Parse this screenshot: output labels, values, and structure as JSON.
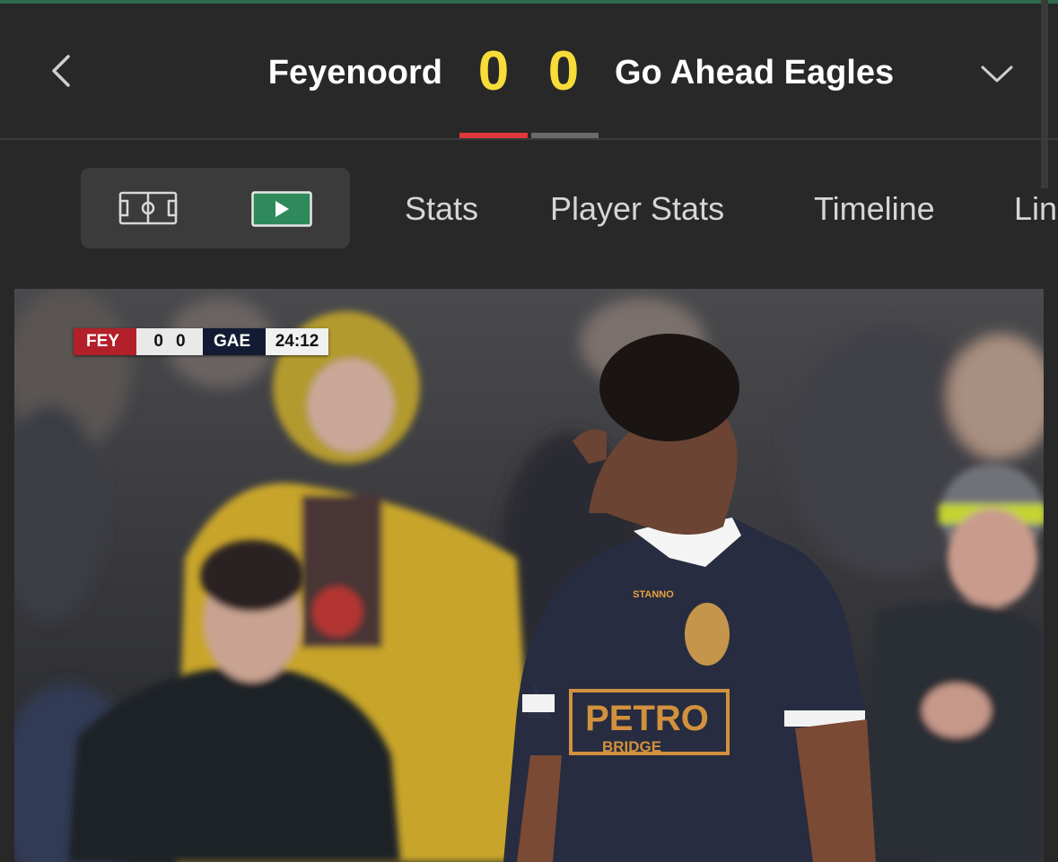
{
  "header": {
    "home_team": "Feyenoord",
    "away_team": "Go Ahead Eagles",
    "home_score": "0",
    "away_score": "0"
  },
  "icons": {
    "back": "chevron-left-icon",
    "dropdown": "chevron-down-icon",
    "pitch": "pitch-icon",
    "video": "play-icon"
  },
  "tabs": [
    {
      "label": "Stats"
    },
    {
      "label": "Player Stats"
    },
    {
      "label": "Timeline"
    },
    {
      "label": "Lin"
    }
  ],
  "video": {
    "scorebug": {
      "home": "FEY",
      "home_score": "0",
      "away_score": "0",
      "away": "GAE",
      "clock": "24:12"
    },
    "sponsor_text": "PETRO",
    "sponsor_sub": "BRIDGE",
    "kit_brand": "STANNO"
  },
  "colors": {
    "background": "#282828",
    "score": "#f7dc3a",
    "momentum_home": "#e0383c",
    "momentum_away": "#6b6b6b",
    "video_button": "#2e8a5a"
  }
}
